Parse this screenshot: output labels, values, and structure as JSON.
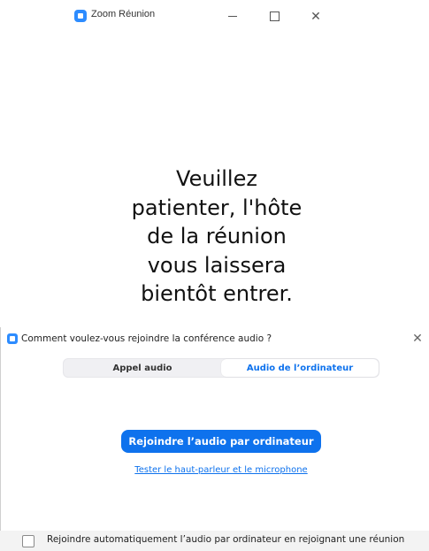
{
  "window": {
    "app_title": "Zoom Réunion",
    "minimize_glyph": "—",
    "maximize_glyph": "☐",
    "close_glyph": "✕"
  },
  "waiting": {
    "lines": [
      "Veuillez",
      "patienter, l'hôte",
      "de la réunion",
      "vous laissera",
      "bientôt entrer."
    ]
  },
  "audio_dialog": {
    "title": "Comment voulez-vous rejoindre la conférence audio ?",
    "close_glyph": "✕",
    "tabs": [
      {
        "label": "Appel audio",
        "active": false
      },
      {
        "label": "Audio de l’ordinateur",
        "active": true
      }
    ],
    "join_button_label": "Rejoindre l’audio par ordinateur",
    "test_link_label": "Tester le haut-parleur et le microphone",
    "auto_join_label": "Rejoindre automatiquement l’audio par ordinateur en rejoignant une réunion",
    "auto_join_checked": false
  },
  "colors": {
    "accent": "#0e72ed",
    "zoom_blue": "#2d8cff"
  },
  "icons": {
    "app": "zoom-logo-icon",
    "minimize": "minimize-icon",
    "maximize": "maximize-icon",
    "close": "close-icon",
    "checkbox": "checkbox-icon"
  }
}
